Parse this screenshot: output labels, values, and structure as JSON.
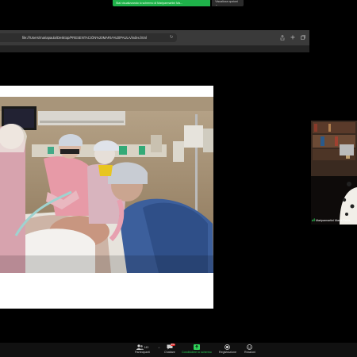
{
  "banner": {
    "notice": "Stai visualizzando lo schermo di Mariparmartini Ma...",
    "view_options": "Visualizza opzioni ⌄"
  },
  "browser": {
    "url": "file:///Users/mariapaula/Desktop/PRESENTACIÓN%20MARIA%20PAULA/index.html"
  },
  "participant": {
    "name": "Mariparmartini María Paula"
  },
  "toolbar": {
    "participants_count": "143",
    "participants_label": "Partecipanti",
    "chat_badge": "99+",
    "chat_label": "Chattare",
    "share_label": "Condividere lo schermo",
    "record_label": "Registrazione",
    "reactions_label": "Reazioni"
  },
  "colors": {
    "share_green": "#1fb24a",
    "toolbar_bg": "#111111"
  }
}
